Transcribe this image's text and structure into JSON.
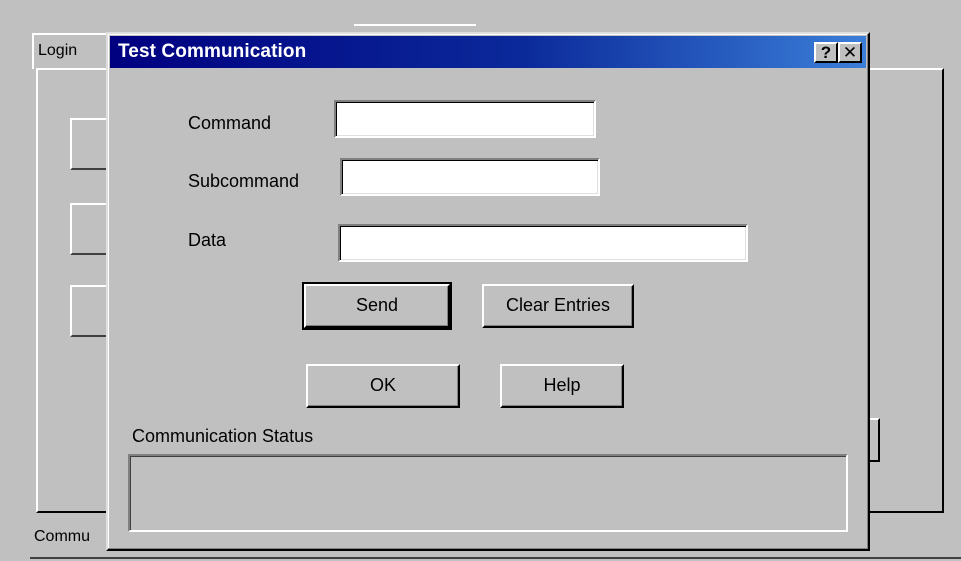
{
  "background": {
    "tab_label": "Login",
    "status_text": "Commu"
  },
  "dialog": {
    "title": "Test Communication",
    "help_button": "?",
    "close_button": "✕",
    "fields": {
      "command_label": "Command",
      "command_value": "",
      "subcommand_label": "Subcommand",
      "subcommand_value": "",
      "data_label": "Data",
      "data_value": ""
    },
    "buttons": {
      "send": "Send",
      "clear": "Clear Entries",
      "ok": "OK",
      "help": "Help"
    },
    "status": {
      "label": "Communication Status",
      "text": ""
    }
  }
}
